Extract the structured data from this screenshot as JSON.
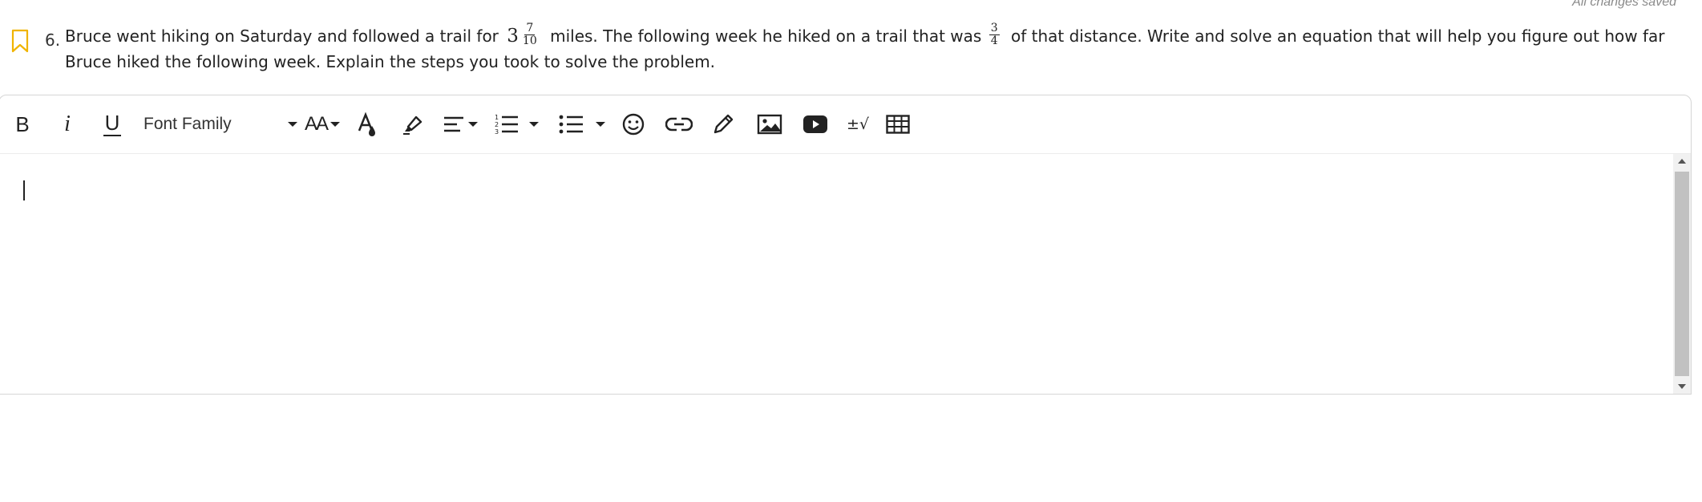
{
  "status": {
    "saved_text": "All changes saved"
  },
  "question": {
    "number": "6.",
    "text_part1": "Bruce went hiking on Saturday and followed a trail for",
    "mixed_whole": "3",
    "mixed_num": "7",
    "mixed_den": "10",
    "text_part2": "miles. The following week he hiked on a trail that was",
    "frac_num": "3",
    "frac_den": "4",
    "text_part3": "of that distance. Write and solve an equation that will help you figure out how far Bruce hiked the following week. Explain the steps you took to solve the problem."
  },
  "toolbar": {
    "bold_label": "B",
    "italic_label": "i",
    "underline_label": "U",
    "font_family_label": "Font Family",
    "font_size_label": "AA",
    "math_label": "±√",
    "icons": [
      "bold",
      "italic",
      "underline",
      "font-family",
      "font-size",
      "text-color",
      "highlight",
      "align",
      "ordered-list",
      "unordered-list",
      "emoji",
      "link",
      "draw",
      "image",
      "video",
      "math",
      "table"
    ]
  },
  "editor": {
    "content": ""
  }
}
